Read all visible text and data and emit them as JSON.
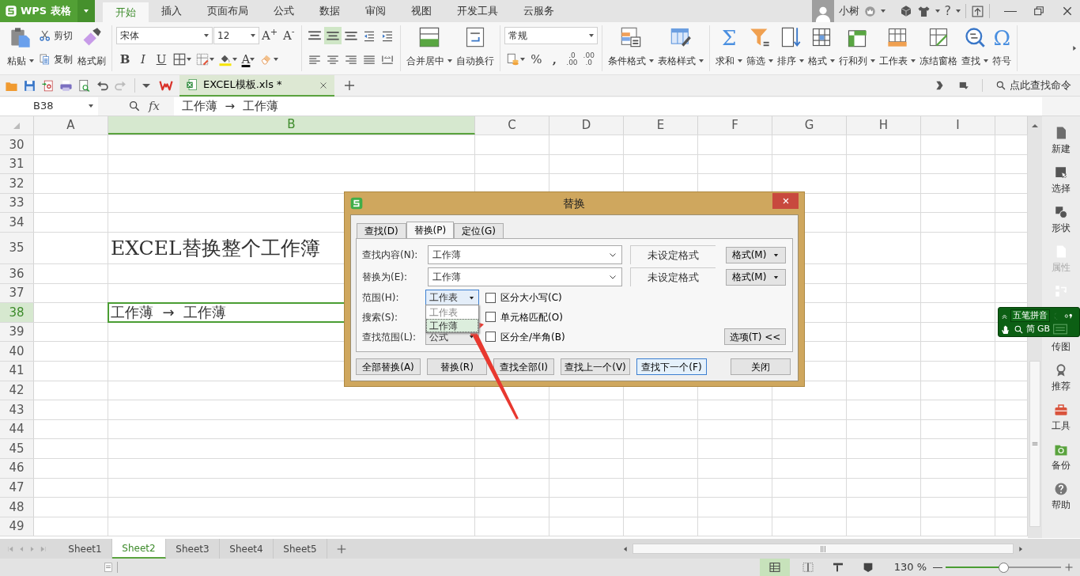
{
  "app": {
    "logo": "WPS 表格"
  },
  "menu_tabs": [
    {
      "label": "开始",
      "selected": true
    },
    {
      "label": "插入",
      "selected": false
    },
    {
      "label": "页面布局",
      "selected": false
    },
    {
      "label": "公式",
      "selected": false
    },
    {
      "label": "数据",
      "selected": false
    },
    {
      "label": "审阅",
      "selected": false
    },
    {
      "label": "视图",
      "selected": false
    },
    {
      "label": "开发工具",
      "selected": false
    },
    {
      "label": "云服务",
      "selected": false
    }
  ],
  "account": {
    "user": "小树",
    "help": "?"
  },
  "ribbon": [
    {
      "items": [
        {
          "kind": "large",
          "label": "粘贴",
          "dropdown": true
        },
        {
          "kind": "stack",
          "rows": [
            [
              {
                "kind": "small",
                "label": "剪切"
              }
            ],
            [
              {
                "kind": "small",
                "label": "复制"
              }
            ]
          ]
        },
        {
          "kind": "large",
          "label": "格式刷",
          "dropdown": false
        }
      ]
    },
    {
      "items": [
        {
          "kind": "stack",
          "rows": [
            [
              {
                "kind": "select",
                "value": "宋体"
              },
              {
                "kind": "select",
                "value": "12"
              },
              {
                "kind": "glyph",
                "text": "A$^{+}$"
              },
              {
                "kind": "glyph",
                "text": "A$^{-}$"
              }
            ],
            [
              {
                "kind": "glyph",
                "text": "B"
              },
              {
                "kind": "glyph",
                "text": "I"
              },
              {
                "kind": "glyph",
                "text": "U"
              },
              {
                "kind": "icon",
                "dropdown": true
              },
              {
                "kind": "icon",
                "dropdown": true
              },
              {
                "kind": "icon",
                "dropdown": true
              },
              {
                "kind": "glyph",
                "text": "A",
                "dropdown": true
              },
              {
                "kind": "icon",
                "dropdown": true
              }
            ]
          ]
        }
      ]
    },
    {
      "items": [
        {
          "kind": "stack",
          "rows": [
            [
              {
                "kind": "icon",
                "selected": false
              },
              {
                "kind": "icon",
                "selected": true
              },
              {
                "kind": "icon",
                "selected": false
              },
              {
                "kind": "icon",
                "selected": false
              },
              {
                "kind": "icon",
                "selected": false
              }
            ],
            [
              {
                "kind": "icon",
                "selected": false
              },
              {
                "kind": "icon",
                "selected": false
              },
              {
                "kind": "icon",
                "selected": false
              },
              {
                "kind": "icon",
                "selected": false
              },
              {
                "kind": "icon",
                "selected": false
              }
            ]
          ]
        }
      ]
    },
    {
      "items": [
        {
          "kind": "large",
          "label": "合并居中",
          "dropdown": true
        },
        {
          "kind": "large",
          "label": "自动换行",
          "dropdown": false
        }
      ]
    },
    {
      "items": [
        {
          "kind": "stack",
          "rows": [
            [
              {
                "kind": "select",
                "value": "常规"
              }
            ],
            [
              {
                "kind": "icon",
                "dropdown": true
              },
              {
                "kind": "glyph",
                "text": "%"
              },
              {
                "kind": "glyph",
                "text": ","
              },
              {
                "kind": "glyph2",
                "top": ".0",
                "bottom": ".00"
              },
              {
                "kind": "glyph2",
                "top": ".00",
                "bottom": ".0"
              }
            ]
          ]
        }
      ]
    },
    {
      "items": [
        {
          "kind": "large",
          "label": "条件格式",
          "dropdown": true
        },
        {
          "kind": "large",
          "label": "表格样式",
          "dropdown": true
        }
      ]
    },
    {
      "items": [
        {
          "kind": "large",
          "label": "求和",
          "glyph": "Σ",
          "dropdown": true
        },
        {
          "kind": "large",
          "label": "筛选",
          "dropdown": true
        },
        {
          "kind": "large",
          "label": "排序",
          "dropdown": true
        },
        {
          "kind": "large",
          "label": "格式",
          "dropdown": true
        },
        {
          "kind": "large",
          "label": "行和列",
          "dropdown": true
        },
        {
          "kind": "large",
          "label": "工作表",
          "dropdown": true
        },
        {
          "kind": "large",
          "label": "冻结窗格",
          "dropdown": false
        },
        {
          "kind": "large",
          "label": "查找",
          "dropdown": true
        },
        {
          "kind": "large",
          "label": "符号",
          "glyph": "Ω",
          "dropdown": false
        }
      ]
    }
  ],
  "doc_tab": {
    "title": "EXCEL模板.xls *",
    "selected": true
  },
  "command_search": {
    "placeholder": "点此查找命令"
  },
  "formula_bar": {
    "cell_ref": "B38",
    "fx": "fx",
    "content": "工作薄  →  工作薄"
  },
  "columns": [
    {
      "label": "A",
      "selected": false
    },
    {
      "label": "B",
      "selected": true
    },
    {
      "label": "C",
      "selected": false
    },
    {
      "label": "D",
      "selected": false
    },
    {
      "label": "E",
      "selected": false
    },
    {
      "label": "F",
      "selected": false
    },
    {
      "label": "G",
      "selected": false
    },
    {
      "label": "H",
      "selected": false
    },
    {
      "label": "I",
      "selected": false
    }
  ],
  "rows": [
    {
      "label": "30",
      "selected": false
    },
    {
      "label": "31",
      "selected": false
    },
    {
      "label": "32",
      "selected": false
    },
    {
      "label": "33",
      "selected": false
    },
    {
      "label": "34",
      "selected": false
    },
    {
      "label": "35",
      "selected": false,
      "cells": [
        {},
        {
          "text": "EXCEL替换整个工作簿",
          "kind": "heading"
        }
      ]
    },
    {
      "label": "36",
      "selected": false
    },
    {
      "label": "37",
      "selected": false
    },
    {
      "label": "38",
      "selected": true,
      "cells": [
        {},
        {
          "text": "工作薄  →  工作薄",
          "kind": "text"
        }
      ]
    },
    {
      "label": "39",
      "selected": false
    },
    {
      "label": "40",
      "selected": false
    },
    {
      "label": "41",
      "selected": false
    },
    {
      "label": "42",
      "selected": false
    },
    {
      "label": "43",
      "selected": false
    },
    {
      "label": "44",
      "selected": false
    },
    {
      "label": "45",
      "selected": false
    },
    {
      "label": "46",
      "selected": false
    },
    {
      "label": "47",
      "selected": false
    },
    {
      "label": "48",
      "selected": false
    },
    {
      "label": "49",
      "selected": false
    }
  ],
  "sidebar": [
    {
      "label": "新建",
      "disabled": false
    },
    {
      "label": "选择",
      "disabled": false
    },
    {
      "label": "形状",
      "disabled": false
    },
    {
      "label": "属性",
      "disabled": true
    },
    {
      "disabled": true
    },
    {
      "label": "传图",
      "disabled": false
    },
    {
      "label": "推荐",
      "disabled": false
    },
    {
      "label": "工具",
      "disabled": false
    },
    {
      "label": "备份",
      "disabled": false
    },
    {
      "label": "帮助",
      "disabled": false
    }
  ],
  "ime_toolbar": {
    "mode": "五笔拼音",
    "labels": [
      "简",
      "GB"
    ]
  },
  "dialog": {
    "title": "替换",
    "tabs": [
      {
        "label": "查找(D)",
        "selected": false
      },
      {
        "label": "替换(P)",
        "selected": true
      },
      {
        "label": "定位(G)",
        "selected": false
      }
    ],
    "fields": [
      {
        "label": "查找内容(N):",
        "value": "工作薄",
        "format": "未设定格式",
        "button": "格式(M)"
      },
      {
        "label": "替换为(E):",
        "value": "工作薄",
        "format": "未设定格式",
        "button": "格式(M)"
      }
    ],
    "options": [
      {
        "label": "范围(H):",
        "select": "工作表",
        "focused": true,
        "checkbox": {
          "label": "区分大小写(C)",
          "checked": false
        }
      },
      {
        "label": "搜索(S):",
        "checkbox": {
          "label": "单元格匹配(O)",
          "checked": false
        }
      },
      {
        "label": "查找范围(L):",
        "select": "公式",
        "focused": false,
        "checkbox": {
          "label": "区分全/半角(B)",
          "checked": false
        },
        "button": "选项(T) <<"
      }
    ],
    "dropdown": [
      {
        "label": "工作表",
        "selected": false
      },
      {
        "label": "工作薄",
        "selected": true
      }
    ],
    "buttons": [
      {
        "label": "全部替换(A)",
        "kind": "action",
        "focused": false
      },
      {
        "label": "替换(R)",
        "kind": "action",
        "focused": false
      },
      {
        "label": "查找全部(I)",
        "kind": "action",
        "focused": false
      },
      {
        "label": "查找上一个(V)",
        "kind": "action",
        "focused": false
      },
      {
        "label": "查找下一个(F)",
        "kind": "action",
        "focused": true
      },
      {
        "label": "关闭",
        "kind": "close",
        "focused": false
      }
    ]
  },
  "sheet_tabs": [
    {
      "label": "Sheet1",
      "selected": false
    },
    {
      "label": "Sheet2",
      "selected": true
    },
    {
      "label": "Sheet3",
      "selected": false
    },
    {
      "label": "Sheet4",
      "selected": false
    },
    {
      "label": "Sheet5",
      "selected": false
    }
  ],
  "status_bar": {
    "views": [
      {
        "selected": true
      },
      {
        "selected": false
      },
      {
        "selected": false
      },
      {
        "selected": false
      }
    ],
    "zoom": "130 %",
    "zoom_slider": {
      "level": 0.5
    }
  }
}
